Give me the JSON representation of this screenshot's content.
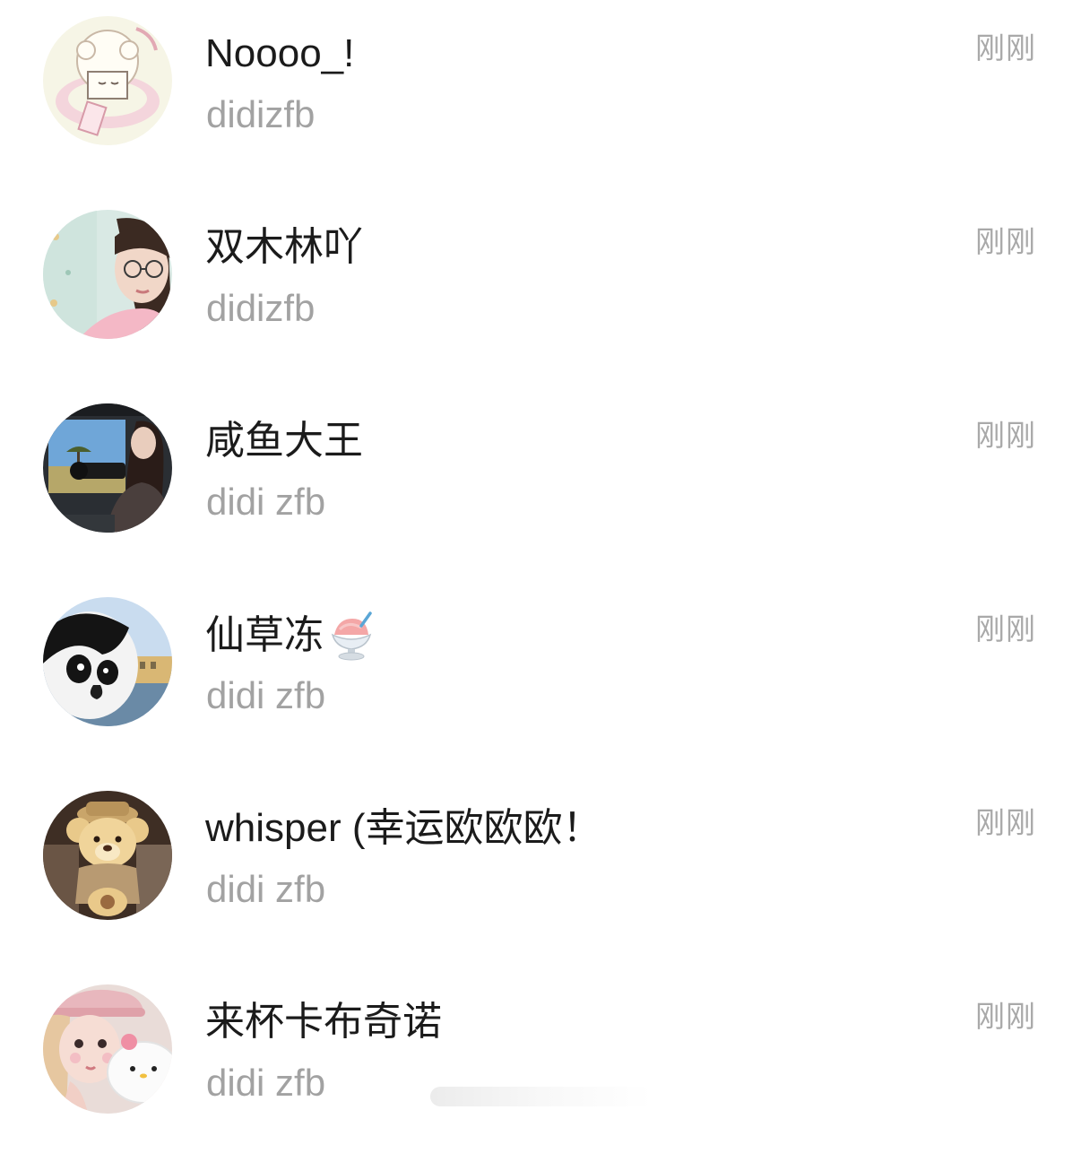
{
  "items": [
    {
      "name": "Noooo_!",
      "subtitle": "didizfb",
      "time": "刚刚",
      "avatar": "cartoon-sheep-avatar"
    },
    {
      "name": "双木林吖",
      "subtitle": "didizfb",
      "time": "刚刚",
      "avatar": "girl-glasses-avatar"
    },
    {
      "name": "咸鱼大王",
      "subtitle": "didi zfb",
      "time": "刚刚",
      "avatar": "safari-camera-avatar"
    },
    {
      "name": "仙草冻",
      "subtitle": "didi zfb",
      "time": "刚刚",
      "avatar": "penguin-avatar",
      "name_icon": "shaved-ice-icon"
    },
    {
      "name": "whisper (幸运欧欧欧！",
      "subtitle": "didi zfb",
      "time": "刚刚",
      "avatar": "teddy-bear-avatar"
    },
    {
      "name": "来杯卡布奇诺",
      "subtitle": "didi zfb",
      "time": "刚刚",
      "avatar": "pink-hat-girl-avatar"
    }
  ]
}
